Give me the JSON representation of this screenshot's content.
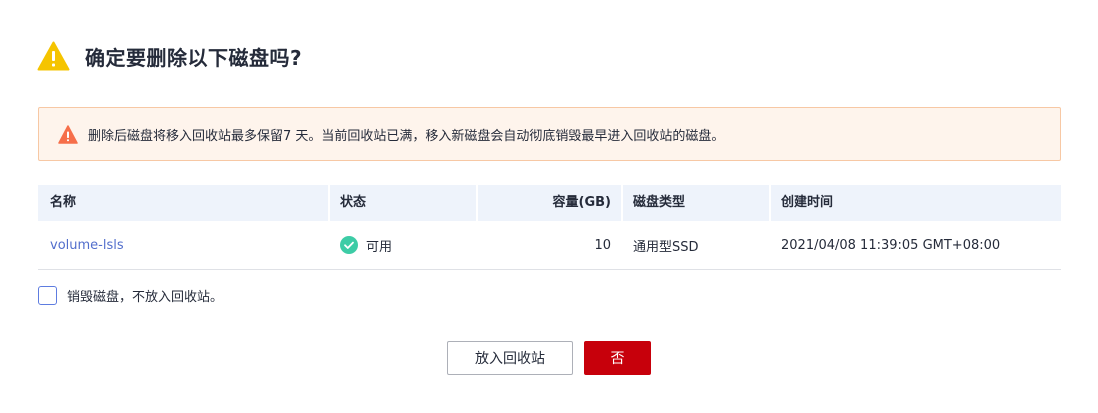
{
  "dialog": {
    "title": "确定要删除以下磁盘吗?",
    "title_icon": "warning-icon",
    "alert": {
      "icon": "warning-icon",
      "text": "删除后磁盘将移入回收站最多保留7 天。当前回收站已满，移入新磁盘会自动彻底销毁最早进入回收站的磁盘。"
    },
    "table": {
      "headers": {
        "name": "名称",
        "status": "状态",
        "capacity": "容量(GB)",
        "type": "磁盘类型",
        "created": "创建时间"
      },
      "rows": [
        {
          "name": "volume-lsls",
          "status": "可用",
          "status_icon": "check-circle-icon",
          "capacity": "10",
          "type": "通用型SSD",
          "created": "2021/04/08 11:39:05 GMT+08:00"
        }
      ]
    },
    "checkbox": {
      "label": "销毁磁盘，不放入回收站。",
      "checked": false
    },
    "buttons": {
      "secondary": "放入回收站",
      "primary": "否"
    },
    "colors": {
      "warning": "#f5a623",
      "alert_bg": "#fef4ec",
      "link": "#526ecc",
      "success": "#3dcca6",
      "danger_button": "#c7000b"
    }
  }
}
